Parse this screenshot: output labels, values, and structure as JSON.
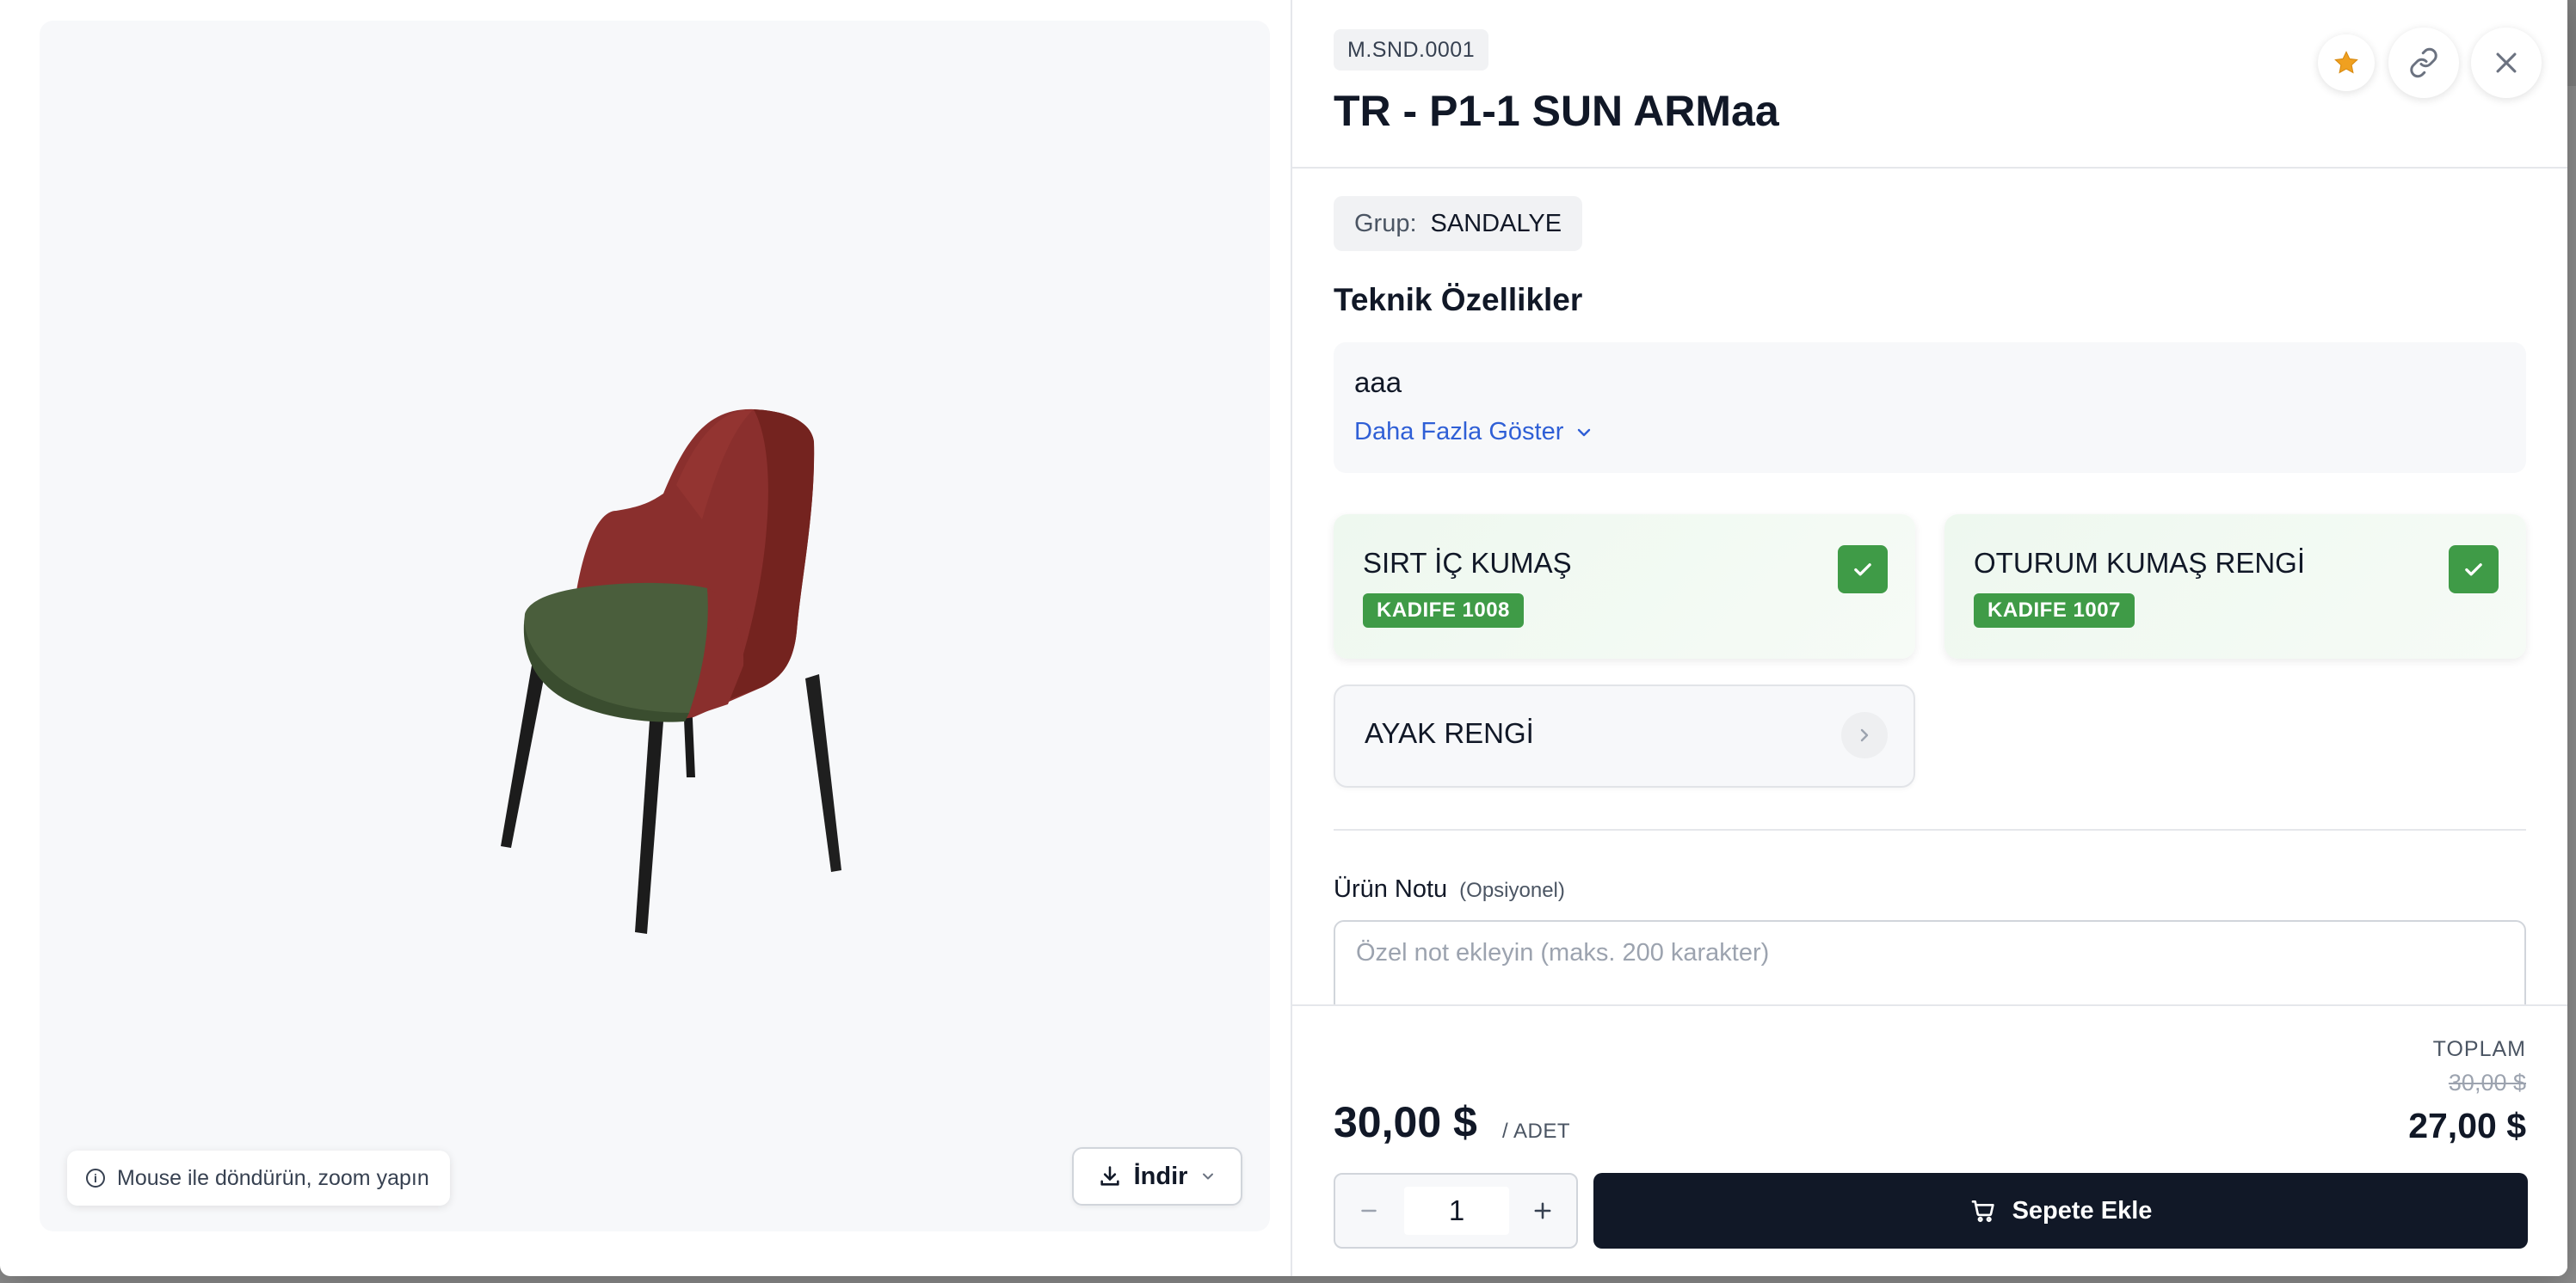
{
  "viewer": {
    "hint_text": "Mouse ile döndürün, zoom yapın",
    "download_label": "İndir"
  },
  "product": {
    "sku": "M.SND.0001",
    "title": "TR - P1-1 SUN ARMaa"
  },
  "group": {
    "label": "Grup:",
    "value": "SANDALYE"
  },
  "specs": {
    "title": "Teknik Özellikler",
    "text": "aaa",
    "more_label": "Daha Fazla Göster"
  },
  "options": [
    {
      "name": "SIRT İÇ KUMAŞ",
      "selected": "KADIFE 1008"
    },
    {
      "name": "OTURUM KUMAŞ RENGİ",
      "selected": "KADIFE 1007"
    },
    {
      "name": "AYAK RENGİ"
    }
  ],
  "note": {
    "label": "Ürün Notu",
    "optional": "(Opsiyonel)",
    "placeholder": "Özel not ekleyin (maks. 200 karakter)"
  },
  "pricing": {
    "unit_price": "30,00 $",
    "unit_label": "/ ADET",
    "total_label": "TOPLAM",
    "total_old": "30,00 $",
    "total_new": "27,00 $"
  },
  "cart": {
    "quantity": "1",
    "add_label": "Sepete Ekle"
  },
  "colors": {
    "accent_green": "#3f9b47",
    "link_blue": "#2f5fd6",
    "dark_button": "#111827",
    "star": "#f0a020"
  },
  "icons": [
    "info-icon",
    "download-icon",
    "chevron-down-icon",
    "star-icon",
    "link-icon",
    "close-icon",
    "check-icon",
    "chevron-right-icon",
    "minus-icon",
    "plus-icon",
    "cart-icon"
  ]
}
